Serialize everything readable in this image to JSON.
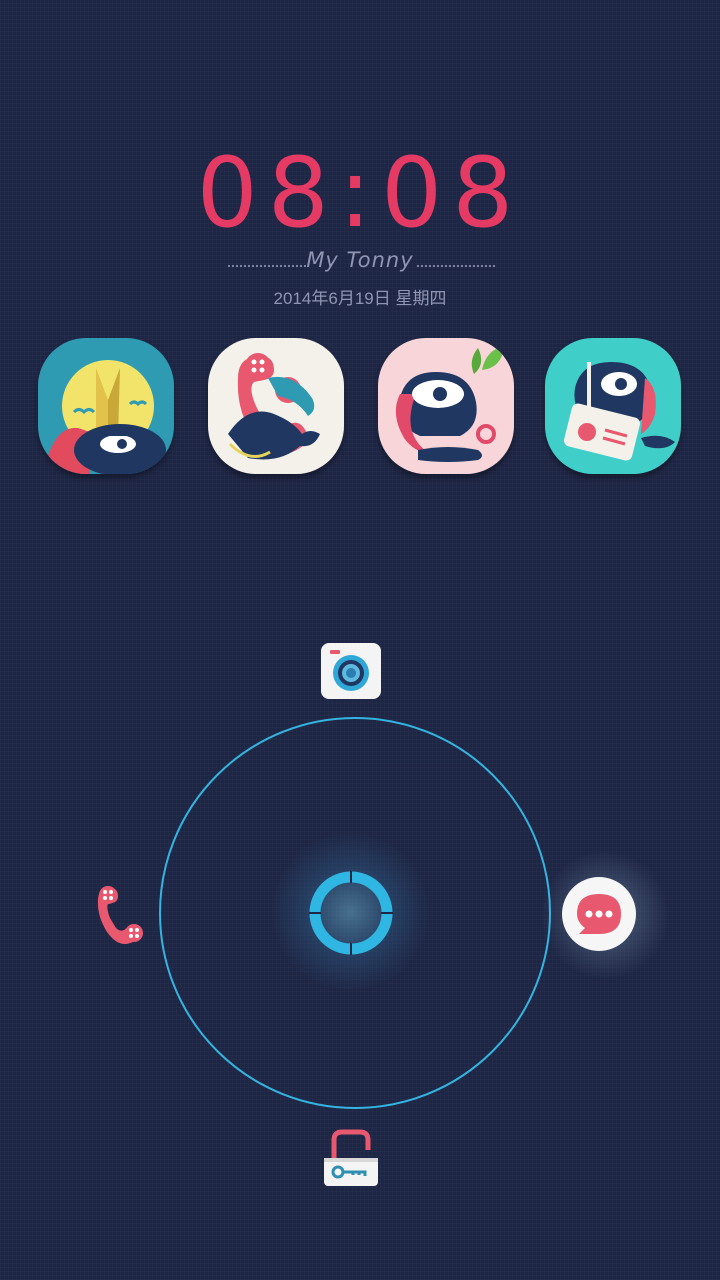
{
  "lockscreen": {
    "time": "08:08",
    "owner_name": "My Tonny",
    "date": "2014年6月19日  星期四"
  },
  "app_icons": [
    {
      "name": "sailing-monster-icon"
    },
    {
      "name": "phone-monster-icon"
    },
    {
      "name": "leaf-monster-icon"
    },
    {
      "name": "radio-monster-icon"
    }
  ],
  "unlock": {
    "shortcuts": {
      "top": "camera-icon",
      "left": "phone-icon",
      "right": "message-icon",
      "bottom": "unlock-icon"
    },
    "colors": {
      "accent": "#e53a63",
      "ring": "#34b4e0",
      "background": "#1e2645"
    }
  }
}
